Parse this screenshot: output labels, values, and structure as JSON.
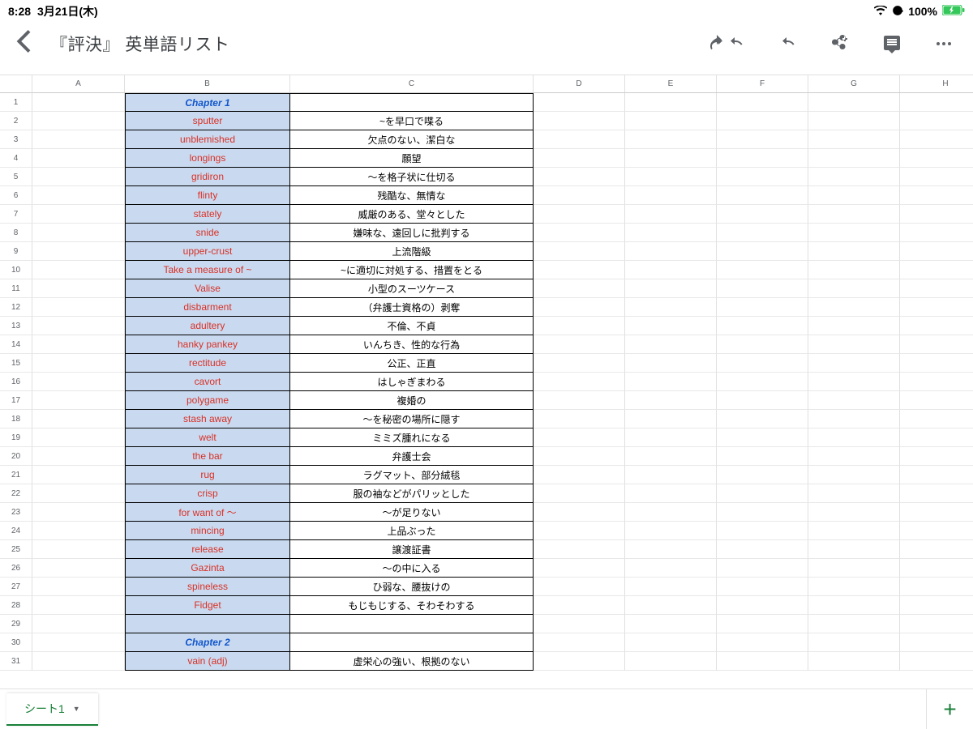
{
  "statusbar": {
    "time": "8:28",
    "date": "3月21日(木)",
    "battery": "100%"
  },
  "header": {
    "title": "『評決』 英単語リスト"
  },
  "columns": [
    "A",
    "B",
    "C",
    "D",
    "E",
    "F",
    "G",
    "H"
  ],
  "rows": [
    {
      "n": 1,
      "b": "Chapter 1",
      "c": "",
      "chapter": true
    },
    {
      "n": 2,
      "b": "sputter",
      "c": "~を早口で喋る"
    },
    {
      "n": 3,
      "b": "unblemished",
      "c": "欠点のない、潔白な"
    },
    {
      "n": 4,
      "b": "longings",
      "c": "願望"
    },
    {
      "n": 5,
      "b": "gridiron",
      "c": "〜を格子状に仕切る"
    },
    {
      "n": 6,
      "b": "flinty",
      "c": "残酷な、無情な"
    },
    {
      "n": 7,
      "b": "stately",
      "c": "威厳のある、堂々とした"
    },
    {
      "n": 8,
      "b": "snide",
      "c": "嫌味な、遠回しに批判する"
    },
    {
      "n": 9,
      "b": "upper-crust",
      "c": "上流階級"
    },
    {
      "n": 10,
      "b": "Take a measure of ~",
      "c": "~に適切に対処する、措置をとる"
    },
    {
      "n": 11,
      "b": "Valise",
      "c": "小型のスーツケース"
    },
    {
      "n": 12,
      "b": "disbarment",
      "c": "（弁護士資格の）剥奪"
    },
    {
      "n": 13,
      "b": "adultery",
      "c": "不倫、不貞"
    },
    {
      "n": 14,
      "b": "hanky pankey",
      "c": "いんちき、性的な行為"
    },
    {
      "n": 15,
      "b": "rectitude",
      "c": "公正、正直"
    },
    {
      "n": 16,
      "b": "cavort",
      "c": "はしゃぎまわる"
    },
    {
      "n": 17,
      "b": "polygame",
      "c": "複婚の"
    },
    {
      "n": 18,
      "b": "stash away",
      "c": "〜を秘密の場所に隠す"
    },
    {
      "n": 19,
      "b": "welt",
      "c": "ミミズ腫れになる"
    },
    {
      "n": 20,
      "b": "the bar",
      "c": "弁護士会"
    },
    {
      "n": 21,
      "b": "rug",
      "c": "ラグマット、部分絨毯"
    },
    {
      "n": 22,
      "b": "crisp",
      "c": "服の袖などがパリッとした"
    },
    {
      "n": 23,
      "b": "for want of 〜",
      "c": "〜が足りない"
    },
    {
      "n": 24,
      "b": "mincing",
      "c": "上品ぶった"
    },
    {
      "n": 25,
      "b": "release",
      "c": "譲渡証書"
    },
    {
      "n": 26,
      "b": "Gazinta",
      "c": "〜の中に入る"
    },
    {
      "n": 27,
      "b": "spineless",
      "c": "ひ弱な、腰抜けの"
    },
    {
      "n": 28,
      "b": "Fidget",
      "c": "もじもじする、そわそわする"
    },
    {
      "n": 29,
      "b": "",
      "c": "",
      "empty": true
    },
    {
      "n": 30,
      "b": "Chapter 2",
      "c": "",
      "chapter": true
    },
    {
      "n": 31,
      "b": "vain (adj)",
      "c": "虚栄心の強い、根拠のない"
    }
  ],
  "bottom": {
    "tab": "シート1",
    "add": "+"
  }
}
